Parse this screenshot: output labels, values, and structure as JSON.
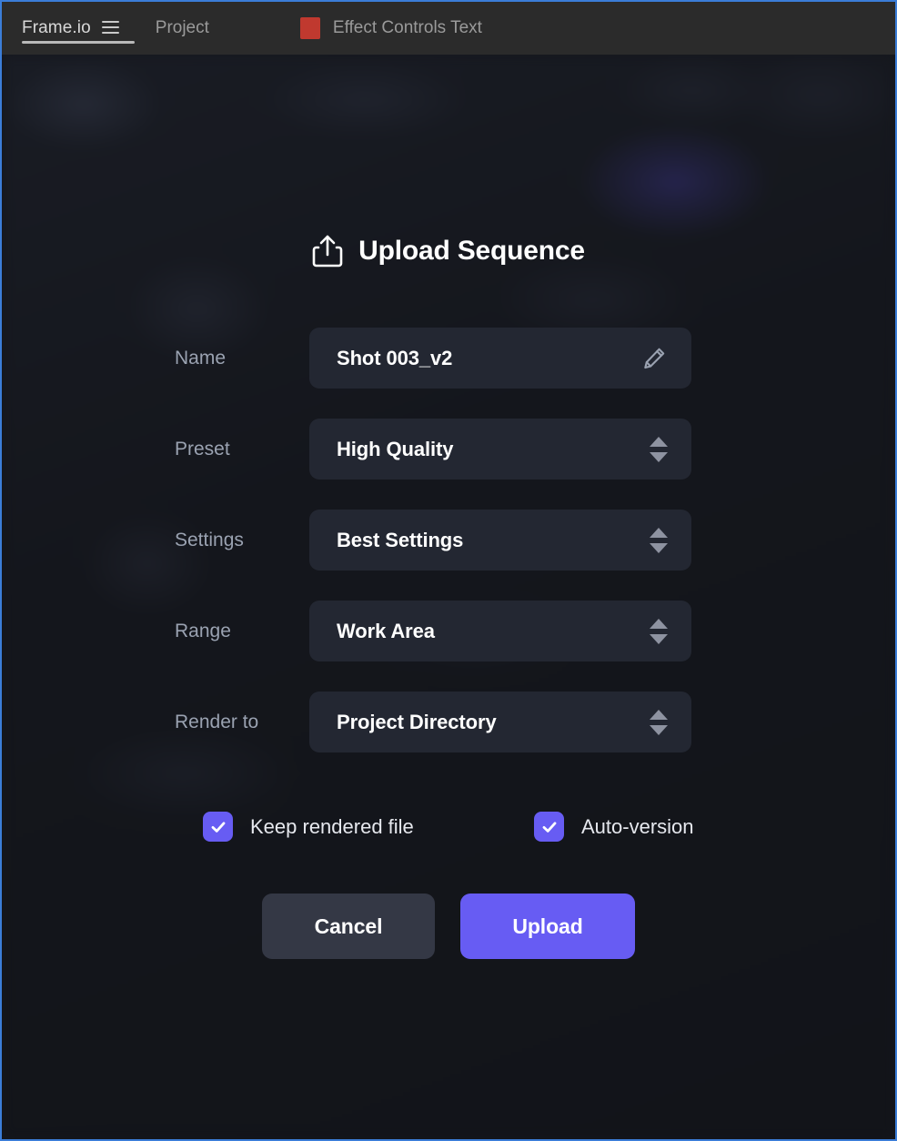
{
  "window": {
    "accent_border_color": "#3b7dd8",
    "background_color": "#15171d"
  },
  "tabbar": {
    "background_color": "#2b2b2b",
    "tabs": [
      {
        "label": "Frame.io",
        "active": true,
        "icon": "hamburger-menu-icon"
      },
      {
        "label": "Project",
        "active": false
      },
      {
        "label": "Effect Controls Text",
        "active": false,
        "swatch_color": "#c0392f"
      }
    ]
  },
  "modal": {
    "title": "Upload Sequence",
    "title_icon": "upload-share-icon",
    "fields": [
      {
        "label": "Name",
        "value": "Shot 003_v2",
        "control": "text-input",
        "icon": "pencil-edit-icon"
      },
      {
        "label": "Preset",
        "value": "High Quality",
        "control": "stepper-select"
      },
      {
        "label": "Settings",
        "value": "Best Settings",
        "control": "stepper-select"
      },
      {
        "label": "Range",
        "value": "Work Area",
        "control": "stepper-select"
      },
      {
        "label": "Render to",
        "value": "Project Directory",
        "control": "stepper-select"
      }
    ],
    "checkboxes": [
      {
        "label": "Keep rendered file",
        "checked": true
      },
      {
        "label": "Auto-version",
        "checked": true
      }
    ],
    "buttons": {
      "cancel": "Cancel",
      "upload": "Upload"
    },
    "colors": {
      "accent": "#675cf3",
      "field_background": "#232732",
      "cancel_background": "#343845",
      "label_text": "#9aa2b1",
      "value_text": "#ffffff"
    }
  }
}
